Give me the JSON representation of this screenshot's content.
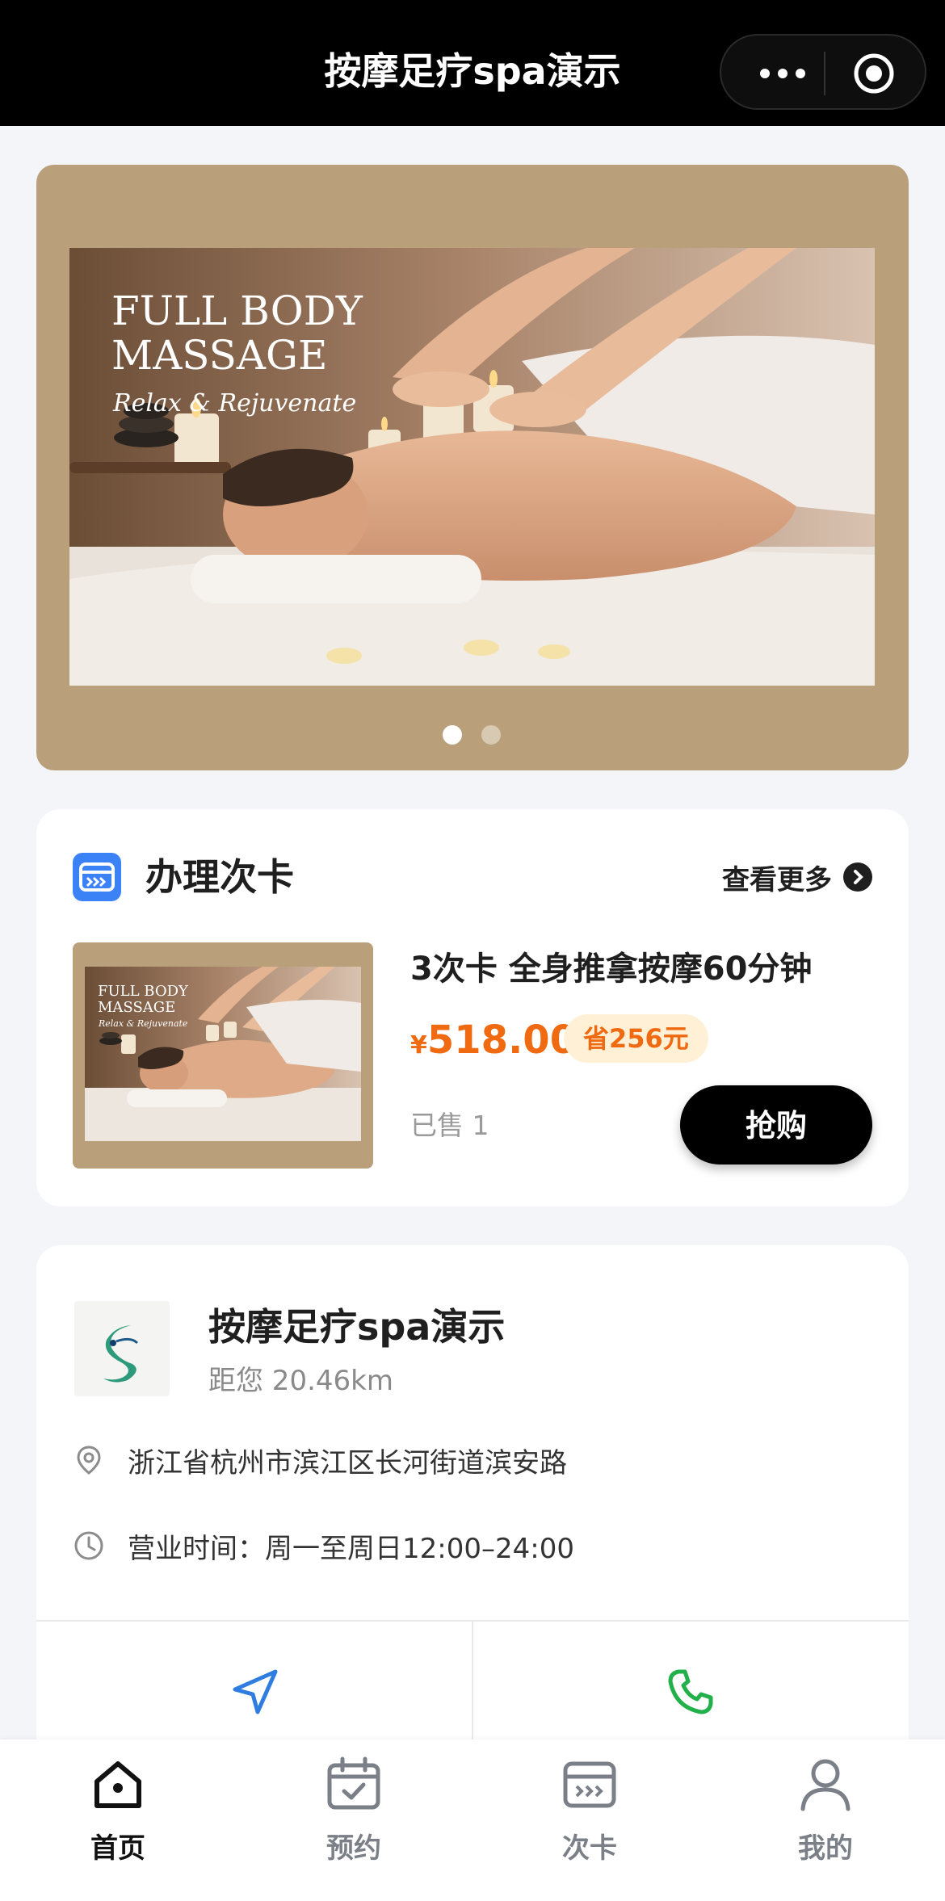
{
  "header": {
    "title": "按摩足疗spa演示"
  },
  "banner": {
    "heading_line1": "FULL BODY",
    "heading_line2": "MASSAGE",
    "tagline": "Relax & Rejuvenate",
    "slide_count": 2,
    "active_slide": 1
  },
  "card_section": {
    "title": "办理次卡",
    "more_label": "查看更多",
    "product": {
      "image_heading_line1": "FULL BODY",
      "image_heading_line2": "MASSAGE",
      "image_tagline": "Relax & Rejuvenate",
      "name": "3次卡 全身推拿按摩60分钟",
      "currency": "¥",
      "price": "518.00",
      "save_label": "省256元",
      "sold_label": "已售 1",
      "buy_label": "抢购"
    }
  },
  "store": {
    "name": "按摩足疗spa演示",
    "distance": "距您 20.46km",
    "address": "浙江省杭州市滨江区长河街道滨安路",
    "hours": "营业时间：周一至周日12:00–24:00"
  },
  "tabbar": {
    "tabs": [
      {
        "label": "首页",
        "icon": "home-icon",
        "active": true
      },
      {
        "label": "预约",
        "icon": "calendar-icon",
        "active": false
      },
      {
        "label": "次卡",
        "icon": "card-icon",
        "active": false
      },
      {
        "label": "我的",
        "icon": "user-icon",
        "active": false
      }
    ]
  },
  "colors": {
    "header_bg": "#000000",
    "banner_bg": "#b9a07b",
    "price": "#ef6a10",
    "save_badge_bg": "#fff0d6",
    "nav_icon": "#2f7de1",
    "call_icon": "#21b04a",
    "active_tab": "#111111",
    "inactive_tab": "#7b7f87"
  }
}
